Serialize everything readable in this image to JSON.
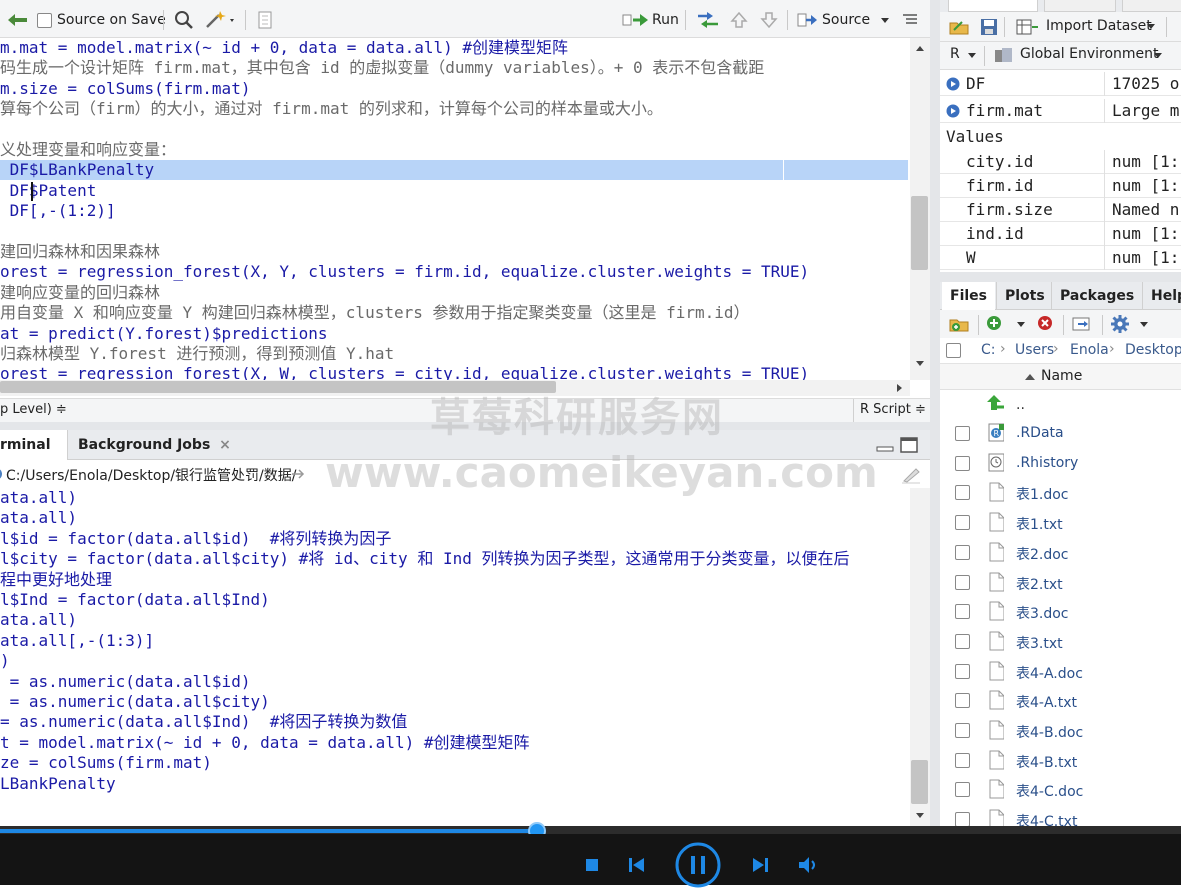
{
  "editor": {
    "toolbar": {
      "source_on_save": "Source on Save",
      "run": "Run",
      "source": "Source"
    },
    "lines": [
      {
        "text": "m.mat = model.matrix(~ id + 0, data = data.all) #创建模型矩阵",
        "highlight": false
      },
      {
        "text": "码生成一个设计矩阵 firm.mat，其中包含 id 的虚拟变量（dummy variables）。+ 0 表示不包含截距",
        "highlight": false
      },
      {
        "text": "m.size = colSums(firm.mat)",
        "highlight": false
      },
      {
        "text": "算每个公司（firm）的大小，通过对 firm.mat 的列求和，计算每个公司的样本量或大小。",
        "highlight": false
      },
      {
        "text": "",
        "highlight": false
      },
      {
        "text": "义处理变量和响应变量：",
        "highlight": false
      },
      {
        "text": " DF$LBankPenalty",
        "highlight": true
      },
      {
        "text": " DF$Patent",
        "highlight": false
      },
      {
        "text": " DF[,-(1:2)]",
        "highlight": false
      },
      {
        "text": "",
        "highlight": false
      },
      {
        "text": "建回归森林和因果森林",
        "highlight": false
      },
      {
        "text": "orest = regression_forest(X, Y, clusters = firm.id, equalize.cluster.weights = TRUE)",
        "highlight": false
      },
      {
        "text": "建响应变量的回归森林",
        "highlight": false
      },
      {
        "text": "用自变量 X 和响应变量 Y 构建回归森林模型，clusters 参数用于指定聚类变量（这里是 firm.id）",
        "highlight": false
      },
      {
        "text": "at = predict(Y.forest)$predictions",
        "highlight": false
      },
      {
        "text": "归森林模型 Y.forest 进行预测，得到预测值 Y.hat",
        "highlight": false
      },
      {
        "text": "orest = regression_forest(X, W, clusters = city.id, equalize.cluster.weights = TRUE)",
        "highlight": false
      }
    ],
    "status_left": "p Level) ≑",
    "status_right": "R Script ≑"
  },
  "console": {
    "tabs": [
      {
        "label": "rminal",
        "close": "×"
      },
      {
        "label": "Background Jobs",
        "close": "×"
      }
    ],
    "path": "C:/Users/Enola/Desktop/银行监管处罚/数据/",
    "lines": [
      "ata.all)",
      "ata.all)",
      "l$id = factor(data.all$id)  #将列转换为因子",
      "l$city = factor(data.all$city) #将 id、city 和 Ind 列转换为因子类型，这通常用于分类变量，以便在后",
      "程中更好地处理",
      "l$Ind = factor(data.all$Ind)",
      "ata.all)",
      "ata.all[,-(1:3)]",
      ")",
      " = as.numeric(data.all$id)",
      " = as.numeric(data.all$city)",
      "= as.numeric(data.all$Ind)  #将因子转换为数值",
      "t = model.matrix(~ id + 0, data = data.all) #创建模型矩阵",
      "ze = colSums(firm.mat)",
      "LBankPenalty"
    ]
  },
  "environment": {
    "import_dataset": "Import Dataset",
    "language": "R",
    "scope": "Global Environment",
    "data_rows": [
      {
        "name": "DF",
        "value": "17025 o"
      },
      {
        "name": "firm.mat",
        "value": "Large m"
      }
    ],
    "values_header": "Values",
    "value_rows": [
      {
        "name": "city.id",
        "value": "num [1:"
      },
      {
        "name": "firm.id",
        "value": "num [1:"
      },
      {
        "name": "firm.size",
        "value": "Named n"
      },
      {
        "name": "ind.id",
        "value": "num [1:"
      },
      {
        "name": "W",
        "value": "num [1:"
      }
    ]
  },
  "files": {
    "tabs": [
      "Files",
      "Plots",
      "Packages",
      "Help"
    ],
    "breadcrumb": [
      "C:",
      "Users",
      "Enola",
      "Desktop"
    ],
    "column_name": "Name",
    "up_label": "..",
    "items": [
      ".RData",
      ".Rhistory",
      "表1.doc",
      "表1.txt",
      "表2.doc",
      "表2.txt",
      "表3.doc",
      "表3.txt",
      "表4-A.doc",
      "表4-A.txt",
      "表4-B.doc",
      "表4-B.txt",
      "表4-C.doc",
      "表4-C.txt"
    ]
  },
  "player": {
    "progress": 0.455
  },
  "watermark": {
    "line1": "草莓科研服务网",
    "line2": "www.caomeikeyan.com"
  },
  "colors": {
    "accent": "#1e88e5",
    "selection": "#b8d4f8",
    "code_blue": "#1a1aa6"
  }
}
